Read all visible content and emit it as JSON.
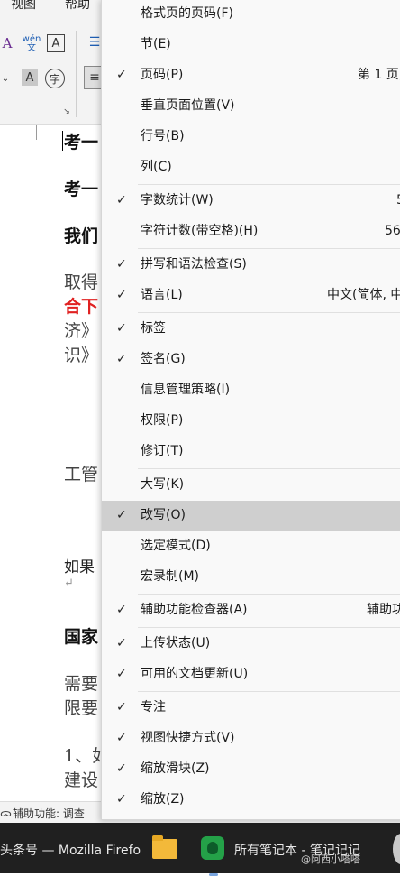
{
  "ribbon": {
    "tabs": [
      "视图",
      "帮助"
    ],
    "phonetic_top": "wén",
    "phonetic_bottom": "文",
    "char_border": "A",
    "shading": "A",
    "enclosed": "字",
    "text_effects": "A"
  },
  "document": {
    "lines": [
      "考一",
      "考一",
      "我们",
      "取得",
      "合下",
      "济》",
      "识》",
      "工管",
      "如果",
      "↵",
      "国家",
      "需要",
      "限要",
      "1、如",
      "建设"
    ]
  },
  "statusbar": {
    "text": "辅助功能: 调查"
  },
  "taskbar": {
    "firefox_title": "头条号 — Mozilla Firefo",
    "notes_title": "所有笔记本 - 笔记记记",
    "watermark": "@阿西小嗒嗒"
  },
  "menu": {
    "items": [
      {
        "checked": false,
        "label": "格式页的页码(F)",
        "value": ""
      },
      {
        "checked": false,
        "label": "节(E)",
        "value": ""
      },
      {
        "checked": true,
        "label": "页码(P)",
        "value": "第 1 页,"
      },
      {
        "checked": false,
        "label": "垂直页面位置(V)",
        "value": ""
      },
      {
        "checked": false,
        "label": "行号(B)",
        "value": ""
      },
      {
        "checked": false,
        "label": "列(C)",
        "value": ""
      },
      {
        "checked": true,
        "label": "字数统计(W)",
        "value": "5"
      },
      {
        "checked": false,
        "label": "字符计数(带空格)(H)",
        "value": "56"
      },
      {
        "checked": true,
        "label": "拼写和语法检查(S)",
        "value": ""
      },
      {
        "checked": true,
        "label": "语言(L)",
        "value": "中文(简体, 中"
      },
      {
        "checked": true,
        "label": "标签",
        "value": ""
      },
      {
        "checked": true,
        "label": "签名(G)",
        "value": ""
      },
      {
        "checked": false,
        "label": "信息管理策略(I)",
        "value": ""
      },
      {
        "checked": false,
        "label": "权限(P)",
        "value": ""
      },
      {
        "checked": false,
        "label": "修订(T)",
        "value": ""
      },
      {
        "checked": false,
        "label": "大写(K)",
        "value": ""
      },
      {
        "checked": true,
        "label": "改写(O)",
        "value": ""
      },
      {
        "checked": false,
        "label": "选定模式(D)",
        "value": ""
      },
      {
        "checked": false,
        "label": "宏录制(M)",
        "value": ""
      },
      {
        "checked": true,
        "label": "辅助功能检查器(A)",
        "value": "辅助功"
      },
      {
        "checked": true,
        "label": "上传状态(U)",
        "value": ""
      },
      {
        "checked": true,
        "label": "可用的文档更新(U)",
        "value": ""
      },
      {
        "checked": true,
        "label": "专注",
        "value": ""
      },
      {
        "checked": true,
        "label": "视图快捷方式(V)",
        "value": ""
      },
      {
        "checked": true,
        "label": "缩放滑块(Z)",
        "value": ""
      },
      {
        "checked": true,
        "label": "缩放(Z)",
        "value": ""
      }
    ],
    "check_glyph": "✓",
    "highlighted_item": "改写(O)"
  }
}
